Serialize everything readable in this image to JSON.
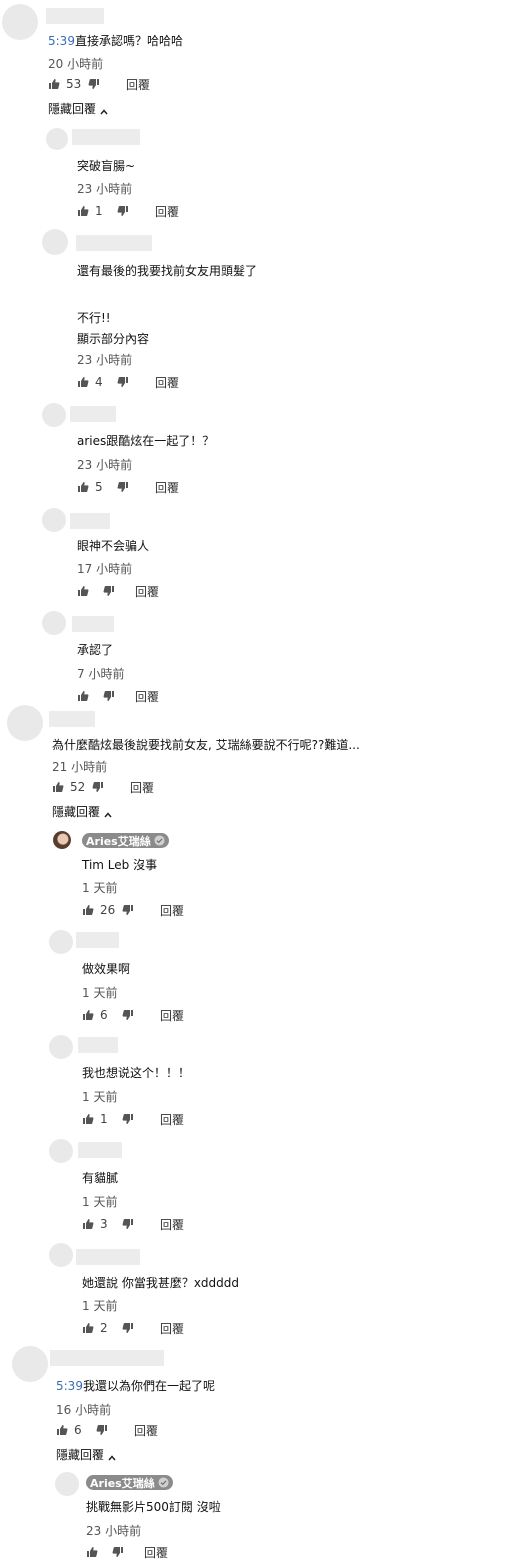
{
  "ui": {
    "reply_label": "回覆",
    "hide_replies_label": "隱藏回覆"
  },
  "threads": [
    {
      "comment": {
        "timestamp_link": "5:39",
        "text": "直接承認嗎？哈哈哈",
        "time": "20 小時前",
        "likes": "53"
      },
      "replies": [
        {
          "text": "突破盲腸~",
          "time": "23 小時前",
          "likes": "1"
        },
        {
          "text_lines": [
            "還有最後的我要找前女友用頭髮了",
            "",
            "不行!!"
          ],
          "show_more": "顯示部分內容",
          "time": "23 小時前",
          "likes": "4"
        },
        {
          "text": "aries跟酷炫在一起了！？",
          "time": "23 小時前",
          "likes": "5"
        },
        {
          "text": "眼神不会骗人",
          "time": "17 小時前",
          "likes": ""
        },
        {
          "text": "承認了",
          "time": "7 小時前",
          "likes": ""
        }
      ]
    },
    {
      "comment": {
        "text": "為什麼酷炫最後說要找前女友, 艾瑞絲要說不行呢??難道...",
        "time": "21 小時前",
        "likes": "52"
      },
      "replies": [
        {
          "author_badge": "Aries艾瑞絲",
          "text": "Tim Leb 沒事",
          "time": "1 天前",
          "likes": "26"
        },
        {
          "text": "做效果啊",
          "time": "1 天前",
          "likes": "6"
        },
        {
          "text": "我也想说这个！！！",
          "time": "1 天前",
          "likes": "1"
        },
        {
          "text": "有貓膩",
          "time": "1 天前",
          "likes": "3"
        },
        {
          "text": "她還說 你當我甚麼？xddddd",
          "time": "1 天前",
          "likes": "2"
        }
      ]
    },
    {
      "comment": {
        "timestamp_link": "5:39",
        "text": "我還以為你們在一起了呢",
        "time": "16 小時前",
        "likes": "6"
      },
      "replies": [
        {
          "author_badge": "Aries艾瑞絲",
          "text": "挑戰無影片500訂閱 沒啦",
          "time": "23 小時前",
          "likes": ""
        }
      ]
    }
  ],
  "icons": {
    "like": "thumbs-up-icon",
    "dislike": "thumbs-down-icon",
    "hide": "chevron-up-icon",
    "verified": "check-circle-icon"
  },
  "colors": {
    "link": "#3b6cb5",
    "badge_bg": "#8b8b8b",
    "icon": "#555555"
  }
}
